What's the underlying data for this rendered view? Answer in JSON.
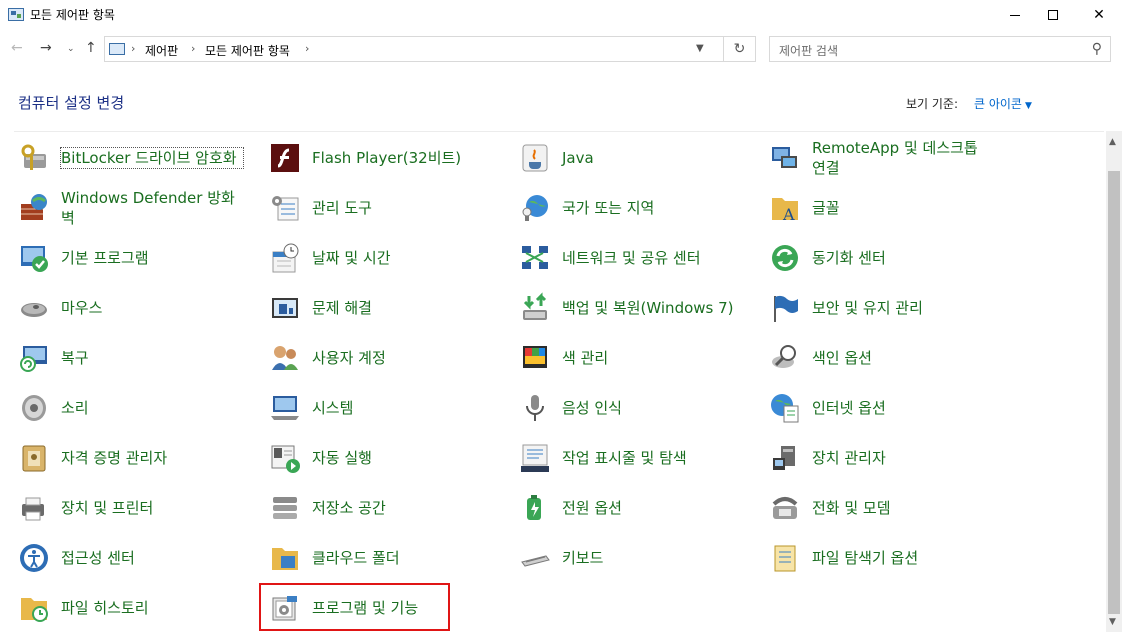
{
  "window": {
    "title": "모든 제어판 항목"
  },
  "address": {
    "crumbs": [
      "제어판",
      "모든 제어판 항목"
    ],
    "search_placeholder": "제어판 검색"
  },
  "header": {
    "title": "컴퓨터 설정 변경",
    "view_by_label": "보기 기준:",
    "view_by_value": "큰 아이콘"
  },
  "items": [
    {
      "label": "BitLocker 드라이브 암호화",
      "icon": "bitlocker-icon"
    },
    {
      "label": "Flash Player(32비트)",
      "icon": "flash-player-icon"
    },
    {
      "label": "Java",
      "icon": "java-icon"
    },
    {
      "label": "RemoteApp 및 데스크톱 연결",
      "icon": "remoteapp-icon"
    },
    {
      "label": "Windows Defender 방화벽",
      "icon": "firewall-icon"
    },
    {
      "label": "관리 도구",
      "icon": "admin-tools-icon"
    },
    {
      "label": "국가 또는 지역",
      "icon": "region-icon"
    },
    {
      "label": "글꼴",
      "icon": "fonts-icon"
    },
    {
      "label": "기본 프로그램",
      "icon": "default-programs-icon"
    },
    {
      "label": "날짜 및 시간",
      "icon": "date-time-icon"
    },
    {
      "label": "네트워크 및 공유 센터",
      "icon": "network-icon"
    },
    {
      "label": "동기화 센터",
      "icon": "sync-center-icon"
    },
    {
      "label": "마우스",
      "icon": "mouse-icon"
    },
    {
      "label": "문제 해결",
      "icon": "troubleshooting-icon"
    },
    {
      "label": "백업 및 복원(Windows 7)",
      "icon": "backup-icon"
    },
    {
      "label": "보안 및 유지 관리",
      "icon": "security-flag-icon"
    },
    {
      "label": "복구",
      "icon": "recovery-icon"
    },
    {
      "label": "사용자 계정",
      "icon": "user-accounts-icon"
    },
    {
      "label": "색 관리",
      "icon": "color-management-icon"
    },
    {
      "label": "색인 옵션",
      "icon": "indexing-icon"
    },
    {
      "label": "소리",
      "icon": "sound-icon"
    },
    {
      "label": "시스템",
      "icon": "system-icon"
    },
    {
      "label": "음성 인식",
      "icon": "speech-icon"
    },
    {
      "label": "인터넷 옵션",
      "icon": "internet-options-icon"
    },
    {
      "label": "자격 증명 관리자",
      "icon": "credential-icon"
    },
    {
      "label": "자동 실행",
      "icon": "autoplay-icon"
    },
    {
      "label": "작업 표시줄 및 탐색",
      "icon": "taskbar-icon"
    },
    {
      "label": "장치 관리자",
      "icon": "device-manager-icon"
    },
    {
      "label": "장치 및 프린터",
      "icon": "printer-icon"
    },
    {
      "label": "저장소 공간",
      "icon": "storage-icon"
    },
    {
      "label": "전원 옵션",
      "icon": "power-icon"
    },
    {
      "label": "전화 및 모뎀",
      "icon": "phone-modem-icon"
    },
    {
      "label": "접근성 센터",
      "icon": "ease-of-access-icon"
    },
    {
      "label": "클라우드 폴더",
      "icon": "cloud-folder-icon"
    },
    {
      "label": "키보드",
      "icon": "keyboard-icon"
    },
    {
      "label": "파일 탐색기 옵션",
      "icon": "folder-options-icon"
    },
    {
      "label": "파일 히스토리",
      "icon": "file-history-icon"
    },
    {
      "label": "프로그램 및 기능",
      "icon": "programs-features-icon"
    }
  ]
}
